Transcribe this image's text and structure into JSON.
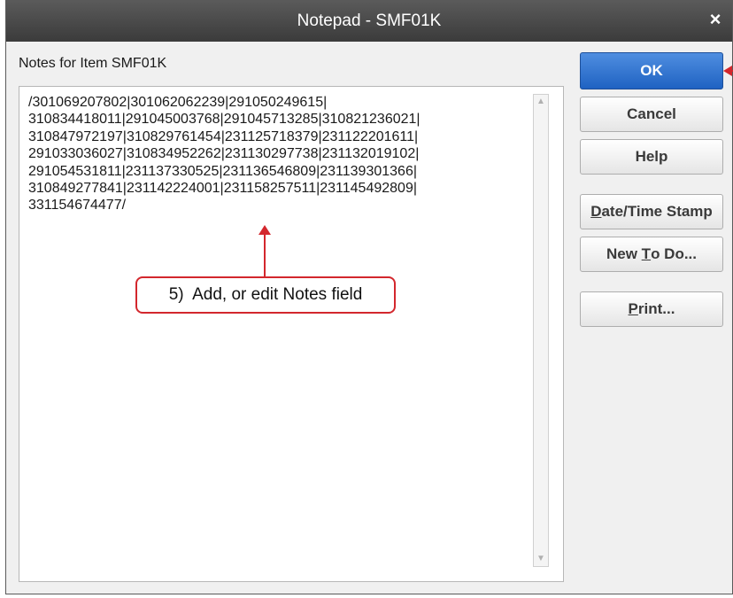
{
  "window": {
    "title": "Notepad - SMF01K",
    "close_glyph": "×"
  },
  "notes": {
    "label": "Notes for Item SMF01K",
    "text": "/301069207802|301062062239|291050249615|\n310834418011|291045003768|291045713285|310821236021|\n310847972197|310829761454|231125718379|231122201611|\n291033036027|310834952262|231130297738|231132019102|\n291054531811|231137330525|231136546809|231139301366|\n310849277841|231142224001|231158257511|231145492809|\n331154674477/"
  },
  "buttons": {
    "ok": "OK",
    "cancel": "Cancel",
    "help": "Help",
    "date_time_stamp": {
      "u": "D",
      "rest": "ate/Time Stamp"
    },
    "new_todo": {
      "pre": "New ",
      "u": "T",
      "rest": "o Do..."
    },
    "print": {
      "u": "P",
      "rest": "rint..."
    }
  },
  "annotation": {
    "callout": "5)  Add, or edit Notes field",
    "color": "#d3272d"
  },
  "scrollbar": {
    "up_icon": "scroll-up-arrow-icon",
    "down_icon": "scroll-down-arrow-icon"
  }
}
